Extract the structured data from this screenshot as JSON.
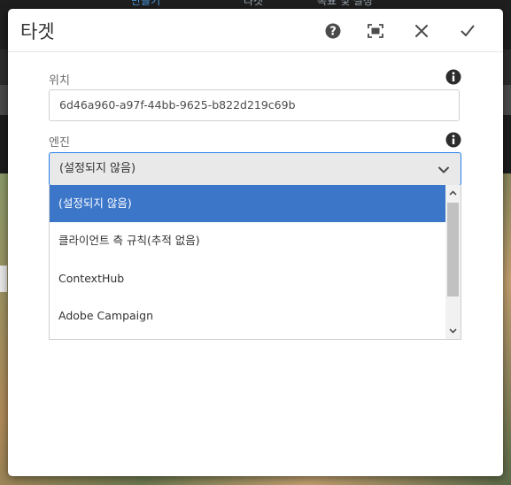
{
  "background": {
    "tabs": [
      "만들기",
      "타겟",
      "목표 및 설정"
    ]
  },
  "dialog": {
    "title": "타겟",
    "icons": {
      "help": "help-icon",
      "fullscreen": "fullscreen-icon",
      "close": "close-icon",
      "confirm": "checkmark-icon"
    },
    "location": {
      "label": "위치",
      "value": "6d46a960-a97f-44bb-9625-b822d219c69b"
    },
    "engine": {
      "label": "엔진",
      "selected": "(설정되지 않음)",
      "options": [
        "(설정되지 않음)",
        "클라이언트 측 규칙(추적 없음)",
        "ContextHub",
        "Adobe Campaign"
      ],
      "selected_index": 0
    }
  },
  "colors": {
    "accent": "#2680eb",
    "selected_option": "#3b76c9"
  }
}
